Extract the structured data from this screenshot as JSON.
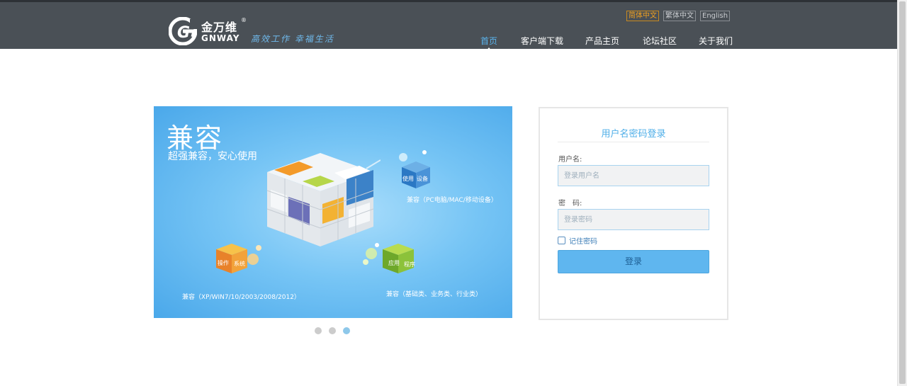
{
  "brand": {
    "name_cn": "金万维",
    "name_en": "GNWAY",
    "registered": "®",
    "slogan": "高效工作 幸福生活",
    "accent": "#5ab4ec"
  },
  "languages": [
    {
      "label": "简体中文",
      "active": true
    },
    {
      "label": "繁体中文",
      "active": false
    },
    {
      "label": "English",
      "active": false
    }
  ],
  "nav": [
    {
      "label": "首页",
      "active": true
    },
    {
      "label": "客户端下载",
      "active": false
    },
    {
      "label": "产品主页",
      "active": false
    },
    {
      "label": "论坛社区",
      "active": false
    },
    {
      "label": "关于我们",
      "active": false
    }
  ],
  "banner": {
    "title": "兼容",
    "subtitle": "超强兼容，安心使用",
    "devices_cube": [
      "使用",
      "设备"
    ],
    "devices_caption": "兼容（PC电脑/MAC/移动设备）",
    "os_cube": [
      "操作",
      "系统"
    ],
    "os_caption": "兼容（XP/WIN7/10/2003/2008/2012）",
    "apps_cube": [
      "应用",
      "程序"
    ],
    "apps_caption": "兼容（基础类、业务类、行业类）",
    "slide_count": 3,
    "active_slide": 3
  },
  "login": {
    "title": "用户名密码登录",
    "username_label": "用户名:",
    "username_placeholder": "登录用户名",
    "password_label": "密　码:",
    "password_placeholder": "登录密码",
    "remember_label": "记住密码",
    "submit_label": "登录"
  }
}
